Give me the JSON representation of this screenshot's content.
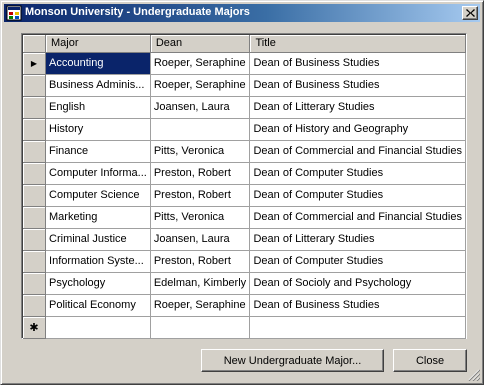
{
  "window": {
    "title": "Monson University - Undergraduate Majors"
  },
  "grid": {
    "columns": [
      "Major",
      "Dean",
      "Title"
    ],
    "rows": [
      {
        "major": "Accounting",
        "dean": "Roeper, Seraphine",
        "title": "Dean of Business Studies"
      },
      {
        "major": "Business Adminis...",
        "dean": "Roeper, Seraphine",
        "title": "Dean of Business Studies"
      },
      {
        "major": "English",
        "dean": "Joansen, Laura",
        "title": "Dean of Litterary Studies"
      },
      {
        "major": "History",
        "dean": "",
        "title": "Dean of History and Geography"
      },
      {
        "major": "Finance",
        "dean": "Pitts, Veronica",
        "title": "Dean of Commercial and Financial Studies"
      },
      {
        "major": "Computer Informa...",
        "dean": "Preston, Robert",
        "title": "Dean of Computer Studies"
      },
      {
        "major": "Computer Science",
        "dean": "Preston, Robert",
        "title": "Dean of Computer Studies"
      },
      {
        "major": "Marketing",
        "dean": "Pitts, Veronica",
        "title": "Dean of Commercial and Financial Studies"
      },
      {
        "major": "Criminal Justice",
        "dean": "Joansen, Laura",
        "title": "Dean of Litterary Studies"
      },
      {
        "major": "Information Syste...",
        "dean": "Preston, Robert",
        "title": "Dean of Computer Studies"
      },
      {
        "major": "Psychology",
        "dean": "Edelman, Kimberly",
        "title": "Dean of Socioly and Psychology"
      },
      {
        "major": "Political Economy",
        "dean": "Roeper, Seraphine",
        "title": "Dean of Business Studies"
      }
    ],
    "current_row_marker": "▶",
    "new_row_marker": "✱"
  },
  "buttons": {
    "new_major": "New Undergraduate Major...",
    "close": "Close"
  },
  "icons": {
    "app": "app-window-icon",
    "close": "close-icon",
    "resize": "resize-grip-icon"
  }
}
